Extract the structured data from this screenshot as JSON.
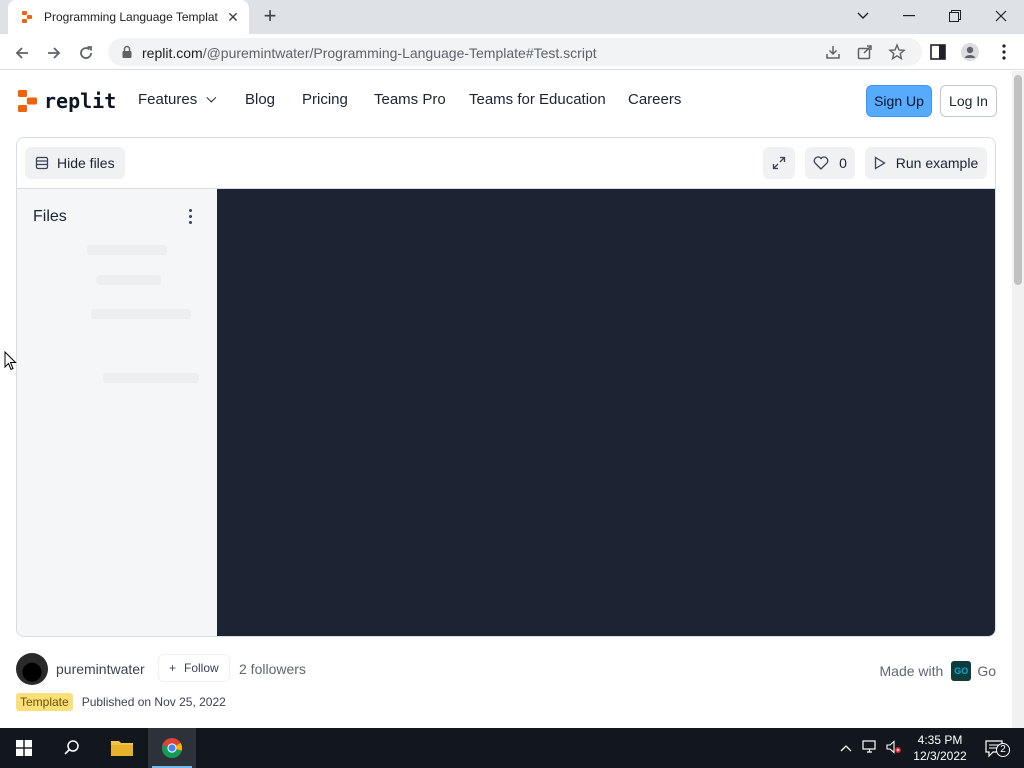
{
  "browser": {
    "tab_title": "Programming Language Templat",
    "url_host": "replit.com",
    "url_path": "/@puremintwater/Programming-Language-Template#Test.script"
  },
  "site": {
    "logo_text": "replit",
    "nav": {
      "features": "Features",
      "blog": "Blog",
      "pricing": "Pricing",
      "teams_pro": "Teams Pro",
      "teams_education": "Teams for Education",
      "careers": "Careers"
    },
    "sign_up": "Sign Up",
    "log_in": "Log In"
  },
  "workspace": {
    "hide_files": "Hide files",
    "like_count": "0",
    "run_example": "Run example",
    "files_title": "Files"
  },
  "owner": {
    "name": "puremintwater",
    "follow_label": "Follow",
    "followers": "2 followers",
    "made_with_label": "Made with",
    "language_badge": "GO",
    "language": "Go",
    "tag": "Template",
    "published": "Published on Nov 25, 2022"
  },
  "taskbar": {
    "time": "4:35 PM",
    "date": "12/3/2022",
    "notification_count": "2"
  },
  "colors": {
    "accent_blue": "#57abff",
    "editor_bg": "#1c2333",
    "tag_yellow": "#fbe07a",
    "replit_orange": "#f26207"
  }
}
